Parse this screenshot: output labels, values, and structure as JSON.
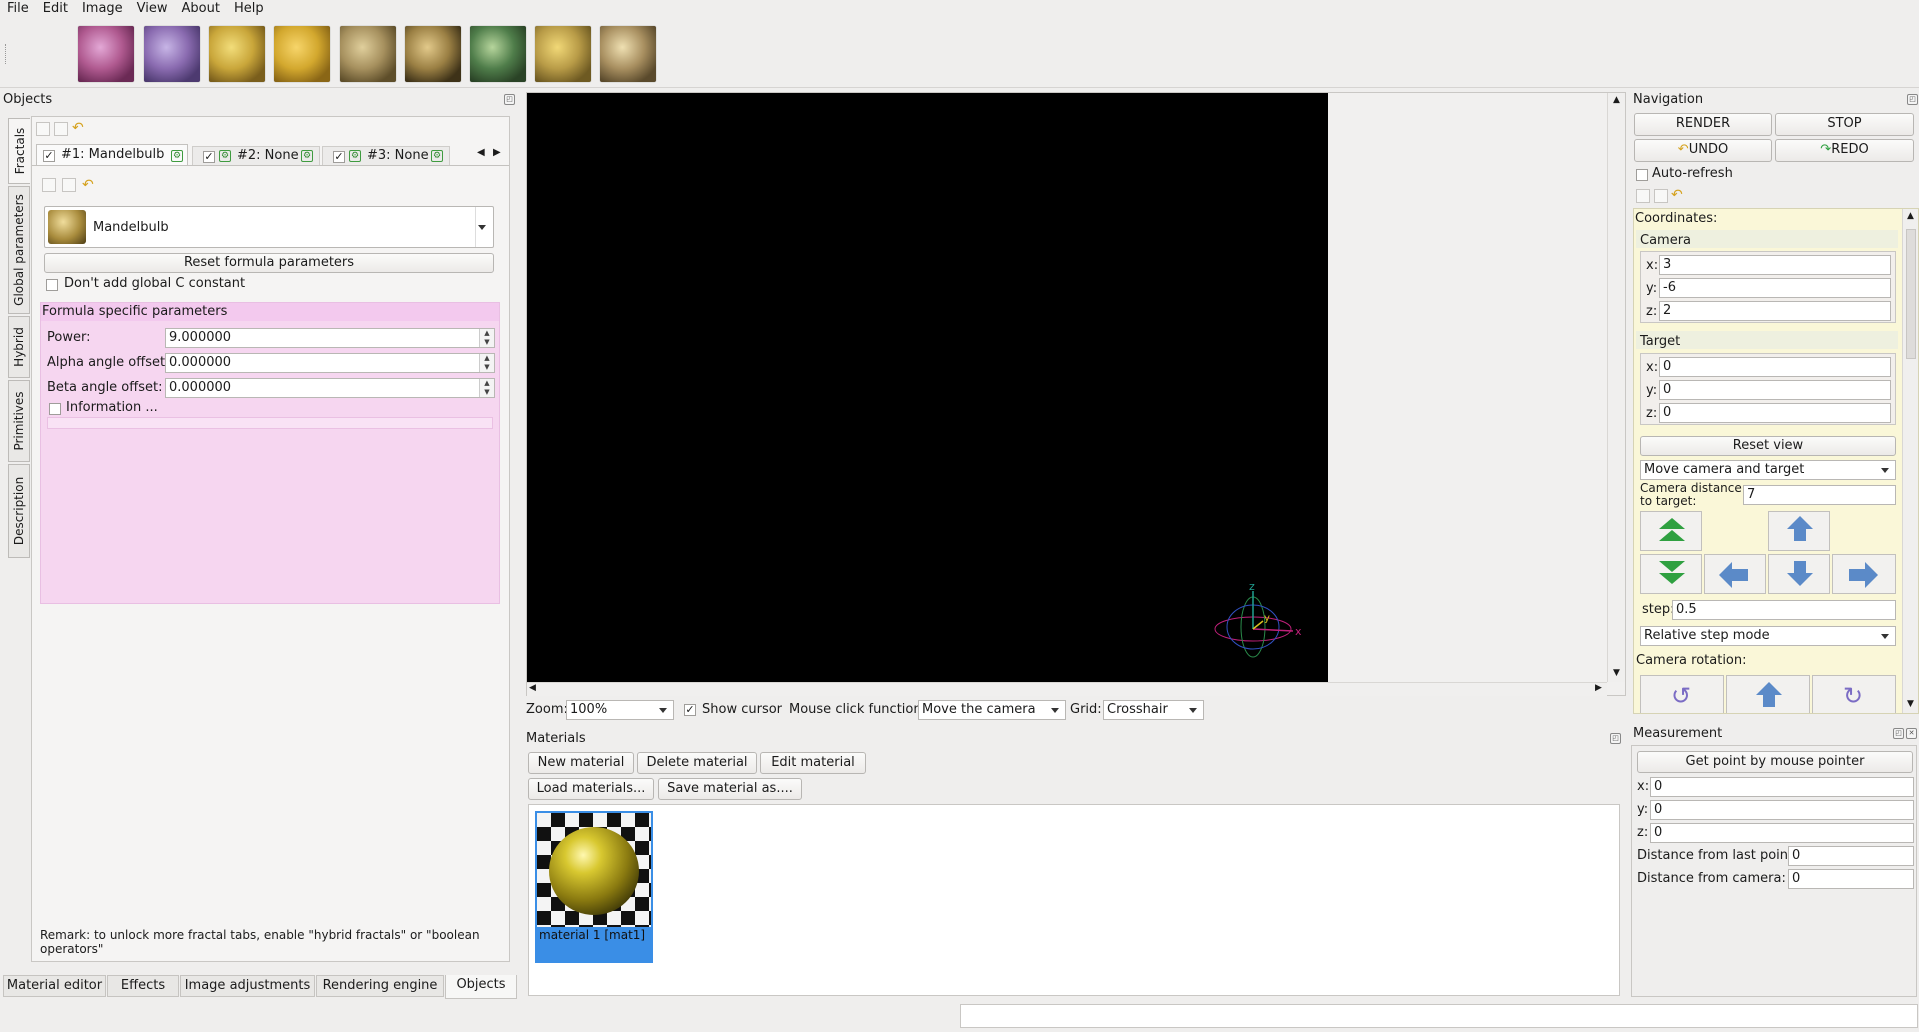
{
  "menu": [
    "File",
    "Edit",
    "Image",
    "View",
    "About",
    "Help"
  ],
  "toolbar": {
    "presets": [
      {
        "icon": "preset-pink-fractal-icon",
        "colors": [
          "#b05a90",
          "#e3a8d6",
          "#6b2a55"
        ]
      },
      {
        "icon": "preset-purple-fractal-icon",
        "colors": [
          "#8a6bb0",
          "#c7b5e6",
          "#4d3a70"
        ]
      },
      {
        "icon": "preset-golden-box-icon",
        "colors": [
          "#c9a63a",
          "#f2dd7a",
          "#7a5e1c"
        ]
      },
      {
        "icon": "preset-gold-cube-icon",
        "colors": [
          "#d3a82e",
          "#f7d56a",
          "#8a6616"
        ]
      },
      {
        "icon": "preset-gold-sculpture-icon",
        "colors": [
          "#a6905e",
          "#e0cf9c",
          "#5e4e2a"
        ]
      },
      {
        "icon": "preset-gold-spheres-icon",
        "colors": [
          "#9b8044",
          "#e2c98a",
          "#3e3218"
        ]
      },
      {
        "icon": "preset-green-menger-icon",
        "colors": [
          "#4f7d4a",
          "#b6d59c",
          "#2a4326"
        ]
      },
      {
        "icon": "preset-gold-pyramid-icon",
        "colors": [
          "#b89b47",
          "#f1d877",
          "#6e5a22"
        ]
      },
      {
        "icon": "preset-gold-spiral-icon",
        "colors": [
          "#a88f60",
          "#efe0b2",
          "#5a4a2c"
        ]
      }
    ]
  },
  "objects": {
    "title": "Objects",
    "side_tabs": [
      "Fractals",
      "Global parameters",
      "Hybrid",
      "Primitives",
      "Description"
    ],
    "fractal_tabs": [
      {
        "label": "#1: Mandelbulb",
        "checked": true
      },
      {
        "label": "#2: None",
        "checked": true
      },
      {
        "label": "#3: None",
        "checked": true
      }
    ],
    "formula": "Mandelbulb",
    "reset_formula": "Reset formula parameters",
    "dont_add_c": "Don't add global C constant",
    "formula_section": "Formula specific parameters",
    "params": [
      {
        "label": "Power:",
        "value": "9.000000"
      },
      {
        "label": "Alpha angle offset:",
        "value": "0.000000"
      },
      {
        "label": "Beta angle offset:",
        "value": "0.000000"
      }
    ],
    "information": "Information ...",
    "remark": "Remark: to unlock more fractal tabs, enable \"hybrid fractals\" or \"boolean operators\"",
    "bottom_tabs": [
      "Material editor",
      "Effects",
      "Image adjustments",
      "Rendering engine",
      "Objects"
    ]
  },
  "viewport": {
    "zoom_label": "Zoom:",
    "zoom_value": "100%",
    "show_cursor": "Show cursor",
    "mouse_click_label": "Mouse click function:",
    "mouse_click_value": "Move the camera",
    "grid_label": "Grid:",
    "grid_value": "Crosshair",
    "axes": {
      "x": "x",
      "y": "y",
      "z": "z"
    }
  },
  "materials": {
    "title": "Materials",
    "buttons": [
      "New material",
      "Delete material",
      "Edit material",
      "Load materials...",
      "Save material as...."
    ],
    "items": [
      {
        "label": "material 1 [mat1]"
      }
    ]
  },
  "navigation": {
    "title": "Navigation",
    "render": "RENDER",
    "stop": "STOP",
    "undo": "UNDO",
    "redo": "REDO",
    "auto_refresh": "Auto-refresh",
    "coordinates": "Coordinates:",
    "camera": "Camera",
    "camera_xyz": [
      {
        "l": "x:",
        "v": "3"
      },
      {
        "l": "y:",
        "v": "-6"
      },
      {
        "l": "z:",
        "v": "2"
      }
    ],
    "target": "Target",
    "target_xyz": [
      {
        "l": "x:",
        "v": "0"
      },
      {
        "l": "y:",
        "v": "0"
      },
      {
        "l": "z:",
        "v": "0"
      }
    ],
    "reset_view": "Reset view",
    "move_mode": "Move camera and target",
    "cam_distance_label": "Camera distance to target:",
    "cam_distance": "7",
    "step_label": "step:",
    "step": "0.5",
    "step_mode": "Relative step mode",
    "camera_rotation": "Camera rotation:"
  },
  "measurement": {
    "title": "Measurement",
    "get_point": "Get point by mouse pointer",
    "xyz": [
      {
        "l": "x:",
        "v": "0"
      },
      {
        "l": "y:",
        "v": "0"
      },
      {
        "l": "z:",
        "v": "0"
      }
    ],
    "dist_last_label": "Distance from last point:",
    "dist_last": "0",
    "dist_camera_label": "Distance from camera:",
    "dist_camera": "0"
  },
  "statusbar": {
    "text": ""
  }
}
